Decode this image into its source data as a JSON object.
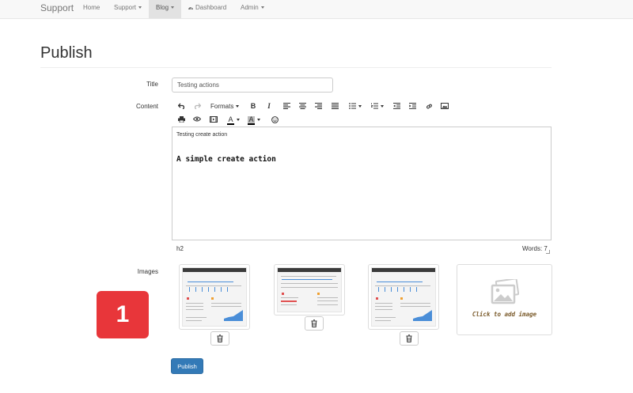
{
  "navbar": {
    "brand": "Support",
    "items": [
      {
        "label": "Home"
      },
      {
        "label": "Support"
      },
      {
        "label": "Blog"
      },
      {
        "label": "Dashboard"
      },
      {
        "label": "Admin"
      }
    ]
  },
  "page": {
    "title": "Publish"
  },
  "form": {
    "title_label": "Title",
    "title_value": "Testing actions",
    "content_label": "Content",
    "images_label": "Images",
    "submit_label": "Publish"
  },
  "toolbar": {
    "formats_label": "Formats"
  },
  "editor": {
    "paragraph": "Testing create action",
    "heading": "A simple create action",
    "status_path": "h2",
    "word_count": "Words: 7"
  },
  "images": {
    "add_caption": "Click to add image"
  },
  "step_badge": "1",
  "colors": {
    "primary": "#337ab7",
    "badge": "#e8363a"
  }
}
